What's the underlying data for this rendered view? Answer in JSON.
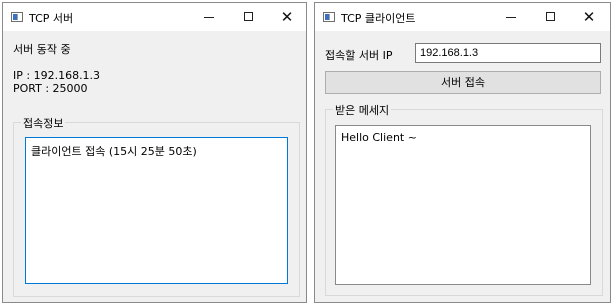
{
  "server": {
    "title": "TCP 서버",
    "window_buttons": {
      "minimize": "–",
      "maximize": "",
      "close": "✕"
    },
    "status": "서버 동작 중",
    "ip_line": "IP : 192.168.1.3",
    "port_line": "PORT : 25000",
    "group_label": "접속정보",
    "log_text": "클라이언트 접속 (15시 25분 50초)"
  },
  "client": {
    "title": "TCP 클라이언트",
    "window_buttons": {
      "minimize": "–",
      "maximize": "",
      "close": "✕"
    },
    "ip_label": "접속할 서버 IP",
    "ip_value": "192.168.1.3",
    "connect_label": "서버 접속",
    "group_label": "받은 메세지",
    "message_text": "Hello Client ~"
  },
  "icons": {
    "app": "app-window-icon",
    "minimize": "minimize-icon",
    "maximize": "maximize-icon",
    "close": "close-icon"
  },
  "colors": {
    "window_background": "#f0f0f0",
    "focus_border": "#0078d7"
  }
}
